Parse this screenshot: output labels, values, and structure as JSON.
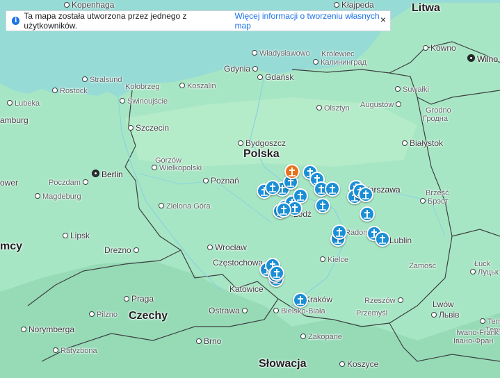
{
  "banner": {
    "text": "Ta mapa została utworzona przez jednego z użytkowników.",
    "link": "Więcej informacji o tworzeniu własnych map",
    "close": "×"
  },
  "countries": {
    "poland": "Polska",
    "lithuania": "Litwa",
    "czechia": "Czechy",
    "slovakia": "Słowacja",
    "germany_partial": "mcy"
  },
  "cities": {
    "kopenhaga": "Kopenhaga",
    "klajpeda": "Kłajpeda",
    "kowno": "Kowno",
    "wilno": "Wilno",
    "wladyslawowo": "Władysławowo",
    "krolewiec": "Królewiec",
    "kaliningrad": "Калининград",
    "gdynia": "Gdynia",
    "gdansk": "Gdańsk",
    "suwalki": "Suwałki",
    "stralsund": "Stralsund",
    "kolobrzeg": "Kołobrzeg",
    "koszalin": "Koszalin",
    "rostock": "Rostock",
    "lubeka": "Lubeka",
    "swinoujscie": "Świnoujście",
    "olsztyn": "Olsztyn",
    "augustow": "Augustów",
    "grodno": "Grodno",
    "grodno_cyr": "Гродна",
    "hamburg": "amburg",
    "szczecin": "Szczecin",
    "bydgoszcz": "Bydgoszcz",
    "bialystok": "Białystok",
    "gorzow": "Gorzów",
    "gorzow2": "Wielkopolski",
    "berlin": "Berlin",
    "poznan": "Poznań",
    "hanower": "ower",
    "poczdam": "Poczdam",
    "magdeburg": "Magdeburg",
    "brzesc": "Brześć",
    "brzesc_cyr": "Брэст",
    "zielona_gora": "Zielona Góra",
    "warszawa": "Warszawa",
    "lodz": "Łódź",
    "radom": "Radom",
    "lipsk": "Lipsk",
    "lublin": "Lublin",
    "drezno": "Drezno",
    "wroclaw": "Wrocław",
    "czestochowa": "Częstochowa",
    "kielce": "Kielce",
    "zamosc": "Zamość",
    "luck": "Łuck",
    "luck_cyr": "Луцьк",
    "praga": "Praga",
    "katowice": "Katowice",
    "krakow": "Kraków",
    "rzeszow": "Rzeszów",
    "lwow": "Lwów",
    "lwow_cyr": "Львів",
    "pilzno": "Pilzno",
    "ostrawa": "Ostrawa",
    "bielsko": "Bielsko-Biała",
    "przemysl": "Przemyśl",
    "norymberga": "Norymberga",
    "ternopil": "Terno",
    "ternopil_cyr": "Терн",
    "ratyzbona": "Ratyzbona",
    "brno": "Brno",
    "zakopane": "Zakopane",
    "iwano": "Iwano-Frank",
    "iwano_cyr": "Івано-Фран",
    "koszyce": "Koszyce"
  },
  "markers": {
    "count_blue": 30,
    "count_orange": 1,
    "icon": "church-icon"
  },
  "colors": {
    "land": "#b6ebc4",
    "sea": "#9fe3d6",
    "marker_blue": "#1a8fd6",
    "marker_orange": "#e8711a",
    "link": "#1a73e8"
  }
}
